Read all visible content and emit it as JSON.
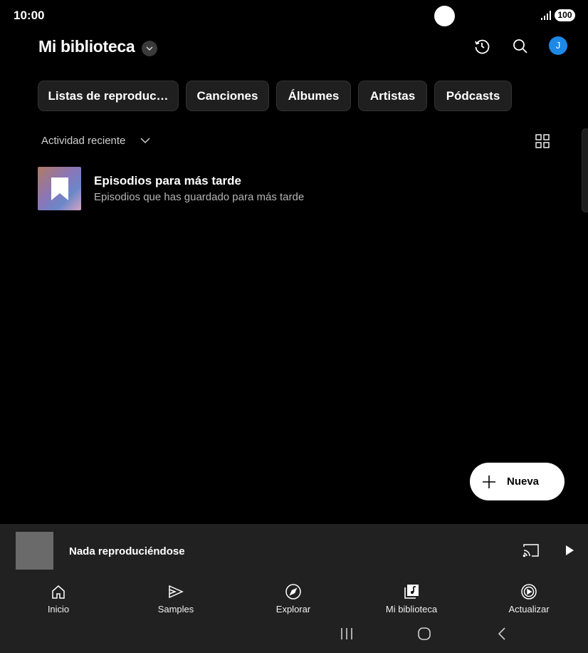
{
  "status": {
    "time": "10:00",
    "battery": "100"
  },
  "header": {
    "title": "Mi biblioteca"
  },
  "chips": [
    "Listas de reproduc…",
    "Canciones",
    "Álbumes",
    "Artistas",
    "Pódcasts"
  ],
  "sort": {
    "label": "Actividad reciente"
  },
  "items": [
    {
      "title": "Episodios para más tarde",
      "subtitle": "Episodios que has guardado para más tarde"
    }
  ],
  "new_button": {
    "label": "Nueva"
  },
  "mini_player": {
    "title": "Nada reproduciéndose"
  },
  "nav": [
    {
      "label": "Inicio",
      "icon": "home-icon"
    },
    {
      "label": "Samples",
      "icon": "samples-icon"
    },
    {
      "label": "Explorar",
      "icon": "compass-icon"
    },
    {
      "label": "Mi biblioteca",
      "icon": "library-icon"
    },
    {
      "label": "Actualizar",
      "icon": "upgrade-icon"
    }
  ],
  "avatar": {
    "initial": "J"
  },
  "colors": {
    "background": "#000000",
    "avatar": "#1e88e5",
    "panel": "#212121",
    "chip": "#1f1f1f"
  }
}
